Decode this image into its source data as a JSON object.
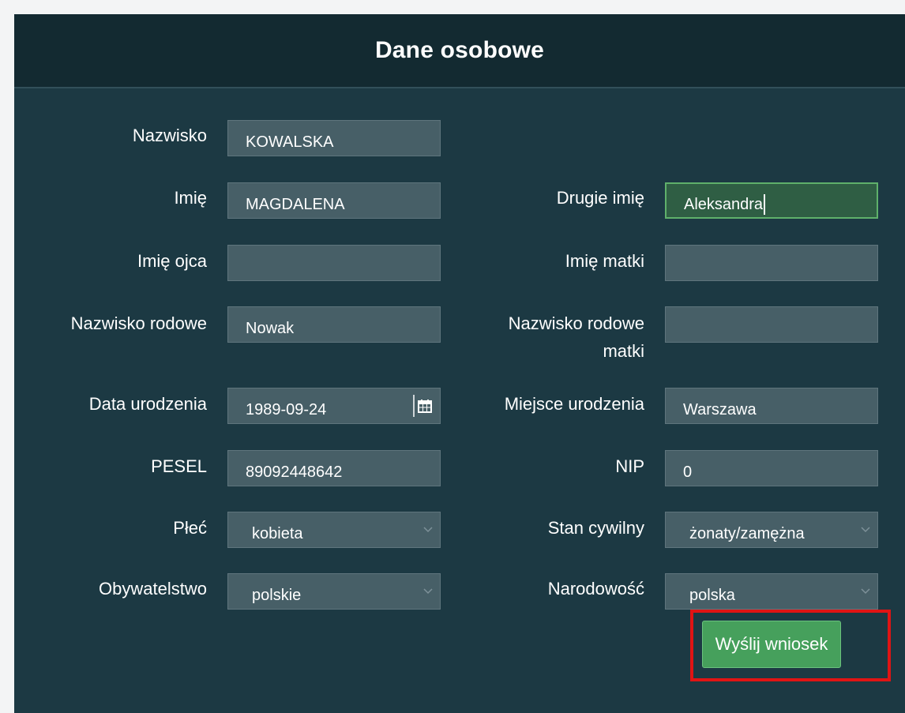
{
  "title": "Dane osobowe",
  "fields": {
    "nazwisko": {
      "label": "Nazwisko",
      "value": "KOWALSKA"
    },
    "imie": {
      "label": "Imię",
      "value": "MAGDALENA"
    },
    "drugie_imie": {
      "label": "Drugie imię",
      "value": "Aleksandra"
    },
    "imie_ojca": {
      "label": "Imię ojca",
      "value": ""
    },
    "imie_matki": {
      "label": "Imię matki",
      "value": ""
    },
    "nazwisko_rodowe": {
      "label": "Nazwisko rodowe",
      "value": "Nowak"
    },
    "nazwisko_rodowe_matki": {
      "label_line1": "Nazwisko rodowe",
      "label_line2": "matki",
      "value": ""
    },
    "data_urodzenia": {
      "label": "Data urodzenia",
      "value": "1989-09-24"
    },
    "miejsce_urodzenia": {
      "label": "Miejsce urodzenia",
      "value": "Warszawa"
    },
    "pesel": {
      "label": "PESEL",
      "value": "89092448642"
    },
    "nip": {
      "label": "NIP",
      "value": "0"
    },
    "plec": {
      "label": "Płeć",
      "value": "kobieta"
    },
    "stan_cywilny": {
      "label": "Stan cywilny",
      "value": "żonaty/zamężna"
    },
    "obywatelstwo": {
      "label": "Obywatelstwo",
      "value": "polskie"
    },
    "narodowosc": {
      "label": "Narodowość",
      "value": "polska"
    }
  },
  "submit_label": "Wyślij wniosek",
  "colors": {
    "panel_bg": "#1c3943",
    "header_bg": "#132a31",
    "field_bg": "#475f67",
    "active_field_bg": "#2f5e44",
    "submit_bg": "#46a05c",
    "highlight_border": "#e01414"
  },
  "icons": {
    "date_picker": "calendar-icon",
    "select": "chevron-down-icon"
  }
}
